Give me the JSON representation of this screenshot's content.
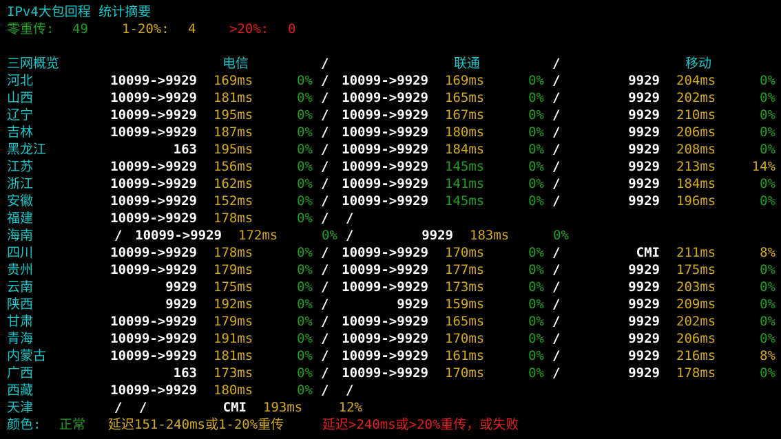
{
  "title": "IPv4大包回程 统计摘要",
  "summary": {
    "zero_label": "零重传: ",
    "zero_value": "49",
    "mid_label": "1-20%: ",
    "mid_value": "4",
    "high_label": ">20%: ",
    "high_value": "0"
  },
  "header": {
    "overview": "三网概览",
    "telecom": "电信",
    "unicom": "联通",
    "mobile": "移动",
    "sep": "/"
  },
  "rows": [
    {
      "province": "河北",
      "ct": {
        "route": "10099->9929",
        "ms": "169ms",
        "loss": "0%"
      },
      "cu": {
        "route": "10099->9929",
        "ms": "169ms",
        "loss": "0%"
      },
      "cm": {
        "route": "9929",
        "ms": "204ms",
        "loss": "0%"
      }
    },
    {
      "province": "山西",
      "ct": {
        "route": "10099->9929",
        "ms": "181ms",
        "loss": "0%"
      },
      "cu": {
        "route": "10099->9929",
        "ms": "165ms",
        "loss": "0%"
      },
      "cm": {
        "route": "9929",
        "ms": "202ms",
        "loss": "0%"
      }
    },
    {
      "province": "辽宁",
      "ct": {
        "route": "10099->9929",
        "ms": "195ms",
        "loss": "0%"
      },
      "cu": {
        "route": "10099->9929",
        "ms": "167ms",
        "loss": "0%"
      },
      "cm": {
        "route": "9929",
        "ms": "210ms",
        "loss": "0%"
      }
    },
    {
      "province": "吉林",
      "ct": {
        "route": "10099->9929",
        "ms": "187ms",
        "loss": "0%"
      },
      "cu": {
        "route": "10099->9929",
        "ms": "180ms",
        "loss": "0%"
      },
      "cm": {
        "route": "9929",
        "ms": "206ms",
        "loss": "0%"
      }
    },
    {
      "province": "黑龙江",
      "ct": {
        "route": "163",
        "ms": "195ms",
        "loss": "0%"
      },
      "cu": {
        "route": "10099->9929",
        "ms": "184ms",
        "loss": "0%"
      },
      "cm": {
        "route": "9929",
        "ms": "208ms",
        "loss": "0%"
      }
    },
    {
      "province": "江苏",
      "ct": {
        "route": "10099->9929",
        "ms": "156ms",
        "loss": "0%"
      },
      "cu": {
        "route": "10099->9929",
        "ms": "145ms",
        "loss": "0%"
      },
      "cm": {
        "route": "9929",
        "ms": "213ms",
        "loss": "14%"
      }
    },
    {
      "province": "浙江",
      "ct": {
        "route": "10099->9929",
        "ms": "162ms",
        "loss": "0%"
      },
      "cu": {
        "route": "10099->9929",
        "ms": "141ms",
        "loss": "0%"
      },
      "cm": {
        "route": "9929",
        "ms": "184ms",
        "loss": "0%"
      }
    },
    {
      "province": "安徽",
      "ct": {
        "route": "10099->9929",
        "ms": "152ms",
        "loss": "0%"
      },
      "cu": {
        "route": "10099->9929",
        "ms": "145ms",
        "loss": "0%"
      },
      "cm": {
        "route": "9929",
        "ms": "196ms",
        "loss": "0%"
      }
    },
    {
      "province": "福建",
      "ct": {
        "route": "10099->9929",
        "ms": "178ms",
        "loss": "0%"
      }
    },
    {
      "province": "海南",
      "cu": {
        "route": "10099->9929",
        "ms": "172ms",
        "loss": "0%"
      },
      "cm": {
        "route": "9929",
        "ms": "183ms",
        "loss": "0%"
      }
    },
    {
      "province": "四川",
      "ct": {
        "route": "10099->9929",
        "ms": "178ms",
        "loss": "0%"
      },
      "cu": {
        "route": "10099->9929",
        "ms": "170ms",
        "loss": "0%"
      },
      "cm": {
        "route": "CMI",
        "ms": "211ms",
        "loss": "8%"
      }
    },
    {
      "province": "贵州",
      "ct": {
        "route": "10099->9929",
        "ms": "179ms",
        "loss": "0%"
      },
      "cu": {
        "route": "10099->9929",
        "ms": "177ms",
        "loss": "0%"
      },
      "cm": {
        "route": "9929",
        "ms": "175ms",
        "loss": "0%"
      }
    },
    {
      "province": "云南",
      "ct": {
        "route": "9929",
        "ms": "175ms",
        "loss": "0%"
      },
      "cu": {
        "route": "10099->9929",
        "ms": "173ms",
        "loss": "0%"
      },
      "cm": {
        "route": "9929",
        "ms": "203ms",
        "loss": "0%"
      }
    },
    {
      "province": "陕西",
      "ct": {
        "route": "9929",
        "ms": "192ms",
        "loss": "0%"
      },
      "cu": {
        "route": "9929",
        "ms": "159ms",
        "loss": "0%"
      },
      "cm": {
        "route": "9929",
        "ms": "209ms",
        "loss": "0%"
      }
    },
    {
      "province": "甘肃",
      "ct": {
        "route": "10099->9929",
        "ms": "179ms",
        "loss": "0%"
      },
      "cu": {
        "route": "10099->9929",
        "ms": "165ms",
        "loss": "0%"
      },
      "cm": {
        "route": "9929",
        "ms": "202ms",
        "loss": "0%"
      }
    },
    {
      "province": "青海",
      "ct": {
        "route": "10099->9929",
        "ms": "191ms",
        "loss": "0%"
      },
      "cu": {
        "route": "10099->9929",
        "ms": "170ms",
        "loss": "0%"
      },
      "cm": {
        "route": "9929",
        "ms": "206ms",
        "loss": "0%"
      }
    },
    {
      "province": "内蒙古",
      "ct": {
        "route": "10099->9929",
        "ms": "181ms",
        "loss": "0%"
      },
      "cu": {
        "route": "10099->9929",
        "ms": "161ms",
        "loss": "0%"
      },
      "cm": {
        "route": "9929",
        "ms": "216ms",
        "loss": "8%"
      }
    },
    {
      "province": "广西",
      "ct": {
        "route": "163",
        "ms": "173ms",
        "loss": "0%"
      },
      "cu": {
        "route": "10099->9929",
        "ms": "170ms",
        "loss": "0%"
      },
      "cm": {
        "route": "9929",
        "ms": "178ms",
        "loss": "0%"
      }
    },
    {
      "province": "西藏",
      "ct": {
        "route": "10099->9929",
        "ms": "180ms",
        "loss": "0%"
      }
    },
    {
      "province": "天津",
      "cm": {
        "route": "CMI",
        "ms": "193ms",
        "loss": "12%"
      }
    }
  ],
  "legend": {
    "label": "颜色: ",
    "normal": "正常",
    "warn": "延迟151-240ms或1-20%重传",
    "bad": "延迟>240ms或>20%重传，或失败"
  },
  "colors": {
    "cyan": "#17c5c8",
    "green": "#229c22",
    "yellow": "#d2a91e",
    "red": "#dd2020",
    "white": "#ffffff",
    "background": "#000000"
  }
}
